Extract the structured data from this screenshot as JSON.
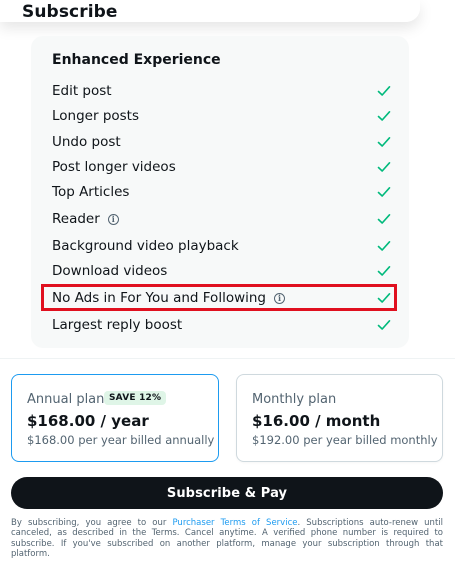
{
  "header": {
    "title": "Subscribe"
  },
  "features": {
    "title": "Enhanced Experience",
    "items": [
      {
        "label": "Edit post",
        "info": false
      },
      {
        "label": "Longer posts",
        "info": false
      },
      {
        "label": "Undo post",
        "info": false
      },
      {
        "label": "Post longer videos",
        "info": false
      },
      {
        "label": "Top Articles",
        "info": false
      },
      {
        "label": "Reader",
        "info": true
      },
      {
        "label": "Background video playback",
        "info": false
      },
      {
        "label": "Download videos",
        "info": false
      },
      {
        "label": "No Ads in For You and Following",
        "info": true,
        "highlighted": true
      },
      {
        "label": "Largest reply boost",
        "info": false
      }
    ],
    "check_color": "#00ba7c"
  },
  "plans": {
    "annual": {
      "name": "Annual plan",
      "badge": "SAVE 12%",
      "price": "$168.00 / year",
      "billed": "$168.00 per year billed annually",
      "selected": true
    },
    "monthly": {
      "name": "Monthly plan",
      "price": "$16.00 / month",
      "billed": "$192.00 per year billed monthly",
      "selected": false
    }
  },
  "cta": {
    "label": "Subscribe & Pay"
  },
  "legal": {
    "prefix": "By subscribing, you agree to our ",
    "link": "Purchaser Terms of Service",
    "suffix": ". Subscriptions auto-renew until canceled, as described in the Terms. Cancel anytime. A verified phone number is required to subscribe. If you've subscribed on another platform, manage your subscription through that platform."
  },
  "colors": {
    "accent": "#1d9bf0",
    "highlight_border": "#e0101f",
    "button_bg": "#0f1419",
    "badge_bg": "#dff5e7"
  }
}
